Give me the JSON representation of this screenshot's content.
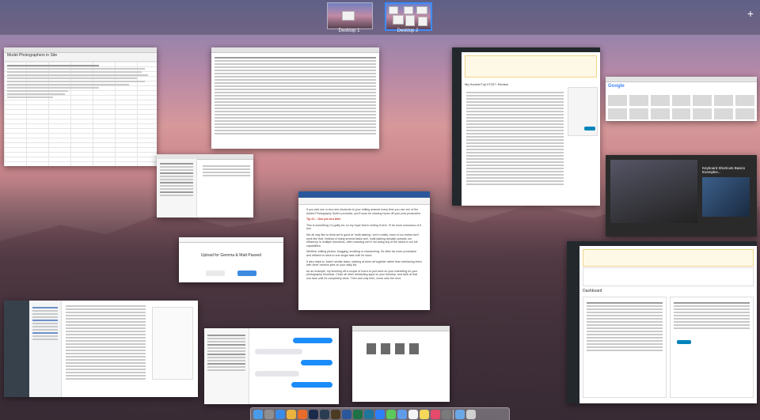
{
  "spaces": {
    "items": [
      {
        "label": "Desktop 1",
        "active": false
      },
      {
        "label": "Desktop 2",
        "active": true
      }
    ],
    "add_symbol": "+"
  },
  "windows": {
    "sheet": {
      "title": "Model Photographers in Site"
    },
    "blog": {
      "title": "My Honest Fuji XT20?: Review"
    },
    "upload": {
      "title": "Upload for Gemma & Matt Passed",
      "button": "Upload"
    },
    "doc": {
      "heading": "Tip #1 – One job at a time",
      "paragraphs": [
        "If you add one or two new shortcuts to your editing arsenal every time you use one of the Adobe Photography Suite's products, you'll soon be shaving hours off your post production.",
        "This is something I'm guilty for, so my hope that in writing it here, I'll be more conscious of it too!",
        "We all may like to think we're good at 'multi-tasking', but in reality, most of our brains don't work like that. Instead of doing several tasks well, multi-tasking actually spreads our efficiency in multiple directions, often meaning we're not doing any of the tasks to our full capabilities.",
        "Whether editing photos, blogging, emailing or researching, it's often far more productive and efficient to stick to one single task until it's done.",
        "It also helps to 'batch' similar tasks, sticking at them all together rather than interlacing them with other random jobs on your daily list.",
        "As an example, my blocking off a couple of hours to just work on your marketing for your photography business. Close all other distracting apps on your desktop, and stick at that one task until it's completely done. Then and only then, move onto the next."
      ]
    },
    "google": {
      "title": "Google"
    },
    "youtube": {
      "title": "Keyboard Shortcuts Basics Examples..."
    },
    "dashboard": {
      "title": "Dashboard"
    }
  },
  "dock": {
    "icons": [
      "finder-icon",
      "launchpad-icon",
      "safari-icon",
      "chrome-icon",
      "firefox-icon",
      "photoshop-icon",
      "lightroom-icon",
      "bridge-icon",
      "word-icon",
      "excel-icon",
      "wordpress-icon",
      "dropbox-icon",
      "messages-icon",
      "mail-icon",
      "calendar-icon",
      "notes-icon",
      "music-icon",
      "preferences-icon",
      "folder-icon",
      "trash-icon"
    ]
  }
}
